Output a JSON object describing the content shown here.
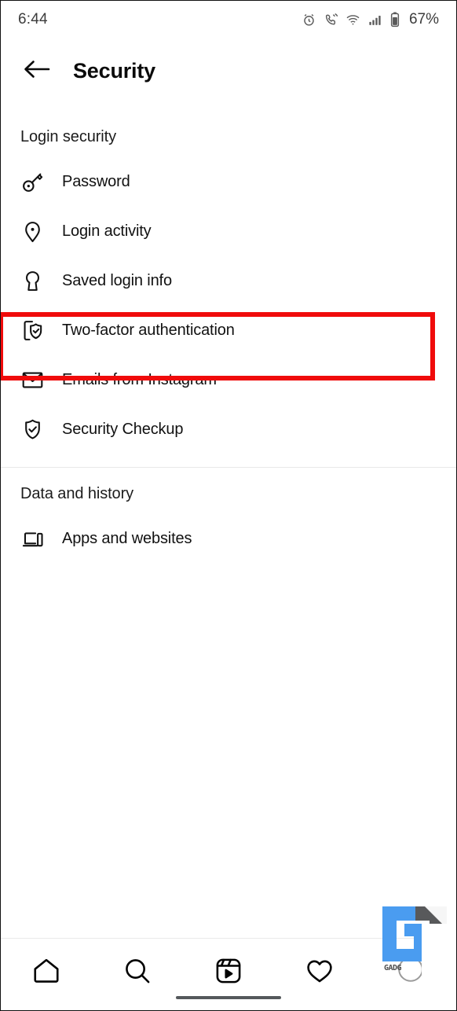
{
  "statusbar": {
    "time": "6:44",
    "battery": "67%",
    "icons": [
      "alarm-icon",
      "call-vibrate-icon",
      "wifi-icon",
      "signal-bars-icon",
      "battery-icon"
    ]
  },
  "header": {
    "back_icon": "back-arrow-icon",
    "title": "Security"
  },
  "sections": [
    {
      "title": "Login security",
      "items": [
        {
          "label": "Password",
          "icon": "key-icon",
          "highlighted": false
        },
        {
          "label": "Login activity",
          "icon": "location-pin-icon",
          "highlighted": false
        },
        {
          "label": "Saved login info",
          "icon": "keyhole-icon",
          "highlighted": false
        },
        {
          "label": "Two-factor authentication",
          "icon": "phone-shield-check-icon",
          "highlighted": true
        },
        {
          "label": "Emails from Instagram",
          "icon": "envelope-icon",
          "highlighted": false
        },
        {
          "label": "Security Checkup",
          "icon": "shield-check-icon",
          "highlighted": false
        }
      ]
    },
    {
      "title": "Data and history",
      "items": [
        {
          "label": "Apps and websites",
          "icon": "laptop-phone-icon",
          "highlighted": false
        }
      ]
    }
  ],
  "bottom_nav": [
    {
      "name": "home",
      "icon": "home-icon"
    },
    {
      "name": "search",
      "icon": "search-icon"
    },
    {
      "name": "reels",
      "icon": "reels-icon"
    },
    {
      "name": "activity",
      "icon": "heart-icon"
    },
    {
      "name": "profile",
      "icon": "profile-avatar-icon"
    }
  ],
  "watermark": {
    "logo": "gu-logo",
    "text": "GADG"
  },
  "colors": {
    "highlight": "#f00b0b",
    "text": "#111111",
    "muted": "#3c3c3c",
    "divider": "#e9e9e9",
    "logo_blue": "#4a9cf0",
    "logo_gray": "#58595b"
  }
}
